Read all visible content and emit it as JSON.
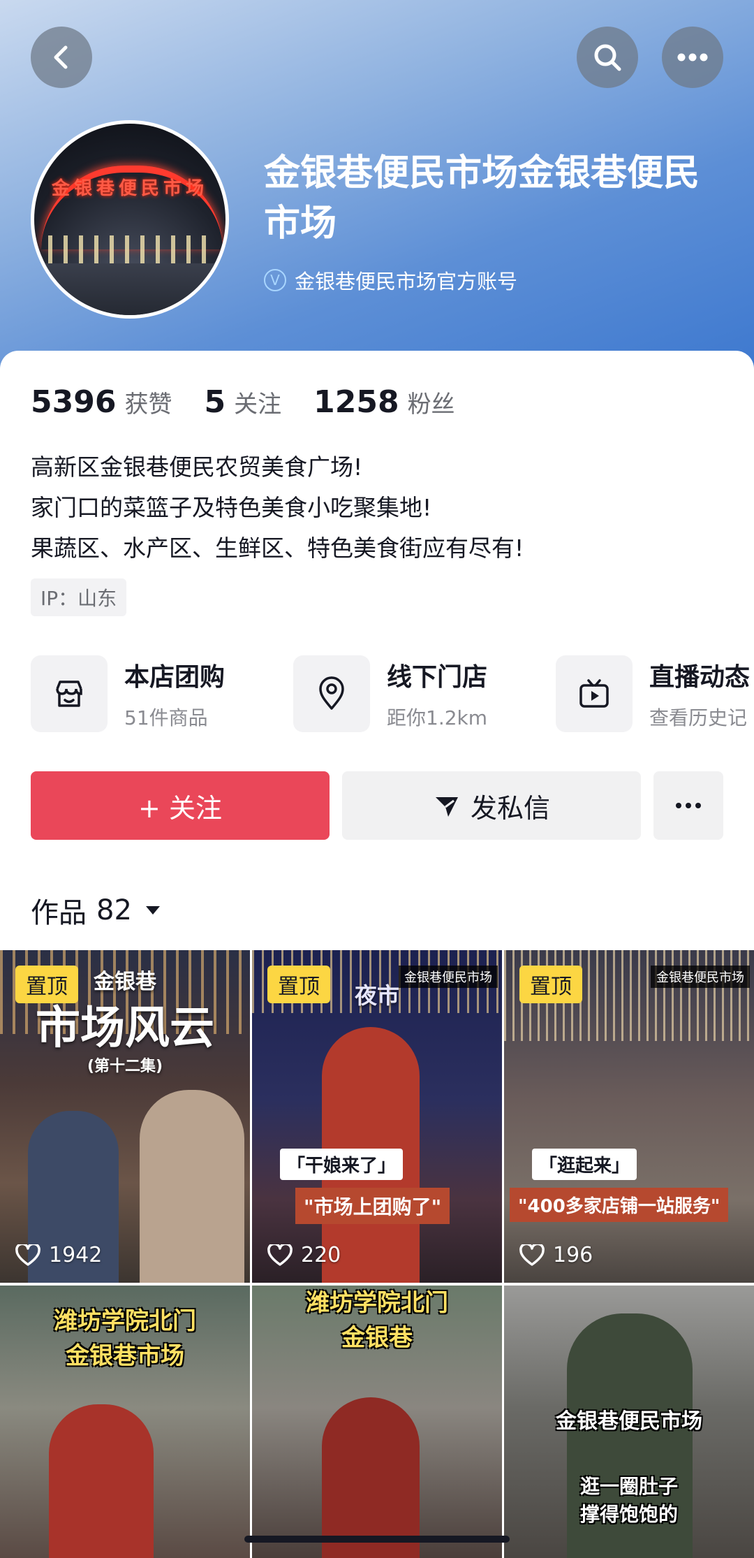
{
  "header": {
    "name": "金银巷便民市场金银巷便民市场",
    "verified_text": "金银巷便民市场官方账号",
    "avatar_sign": "金银巷便民市场"
  },
  "stats": [
    {
      "value": "5396",
      "label": "获赞"
    },
    {
      "value": "5",
      "label": "关注"
    },
    {
      "value": "1258",
      "label": "粉丝"
    }
  ],
  "bio": [
    "高新区金银巷便民农贸美食广场!",
    "家门口的菜篮子及特色美食小吃聚集地!",
    "果蔬区、水产区、生鲜区、特色美食街应有尽有!"
  ],
  "ip": "IP：山东",
  "features": [
    {
      "title": "本店团购",
      "sub": "51件商品",
      "icon": "store-icon"
    },
    {
      "title": "线下门店",
      "sub": "距你1.2km",
      "icon": "location-pin-icon"
    },
    {
      "title": "直播动态",
      "sub": "查看历史记",
      "icon": "tv-icon"
    }
  ],
  "actions": {
    "follow_label": "+ 关注",
    "message_label": "发私信"
  },
  "works": {
    "label": "作品",
    "count": "82"
  },
  "videos": [
    {
      "pinned": "置顶",
      "likes": "1942",
      "overlay": "金银巷",
      "overlay2": "市场风云",
      "overlay3": "(第十二集)"
    },
    {
      "pinned": "置顶",
      "likes": "220",
      "overlay": "夜市",
      "corner": "金银巷便民市场",
      "tag1": "「干娘来了」",
      "tag2": "\"市场上团购了\""
    },
    {
      "pinned": "置顶",
      "likes": "196",
      "corner": "金银巷便民市场",
      "tag1": "「逛起来」",
      "tag2": "\"400多家店铺一站服务\""
    },
    {
      "caption": "潍坊学院北门\n金银巷市场"
    },
    {
      "caption": "潍坊学院北门\n金银巷"
    },
    {
      "caption": "金银巷便民市场",
      "caption2": "逛一圈肚子\n撑得饱饱的"
    }
  ],
  "colors": {
    "follow_red": "#ea4759",
    "pin_yellow": "#fcd643",
    "header_blue": "#5d8fd6"
  }
}
